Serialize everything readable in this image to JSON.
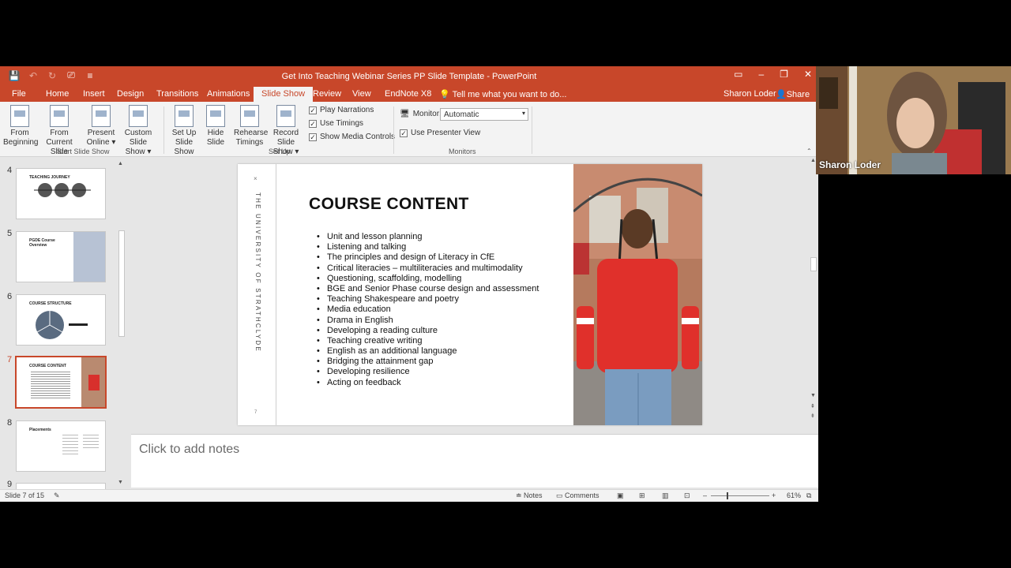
{
  "window": {
    "title": "Get Into Teaching Webinar Series PP Slide Template - PowerPoint",
    "controls": [
      "ribbon-display-icon",
      "minimize-icon",
      "restore-icon",
      "close-icon"
    ]
  },
  "quick_access": [
    "save-icon",
    "undo-icon",
    "redo-icon",
    "start-from-beginning-icon",
    "customize-qat-icon"
  ],
  "tabs": {
    "file": "File",
    "home": "Home",
    "insert": "Insert",
    "design": "Design",
    "transitions": "Transitions",
    "animations": "Animations",
    "slideshow": "Slide Show",
    "review": "Review",
    "view": "View",
    "endnote": "EndNote X8",
    "tell": "Tell me what you want to do...",
    "user": "Sharon Loder",
    "share": "Share"
  },
  "ribbon": {
    "from_beginning_1": "From",
    "from_beginning_2": "Beginning",
    "from_current_1": "From",
    "from_current_2": "Current Slide",
    "present_online_1": "Present",
    "present_online_2": "Online ▾",
    "custom_show_1": "Custom Slide",
    "custom_show_2": "Show ▾",
    "group_start": "Start Slide Show",
    "setup_1": "Set Up",
    "setup_2": "Slide Show",
    "hide_1": "Hide",
    "hide_2": "Slide",
    "rehearse_1": "Rehearse",
    "rehearse_2": "Timings",
    "record_1": "Record Slide",
    "record_2": "Show ▾",
    "play_narrations": "Play Narrations",
    "use_timings": "Use Timings",
    "show_media_controls": "Show Media Controls",
    "group_setup": "Set Up",
    "monitor_label": "Monitor:",
    "monitor_value": "Automatic",
    "use_presenter_view": "Use Presenter View",
    "group_monitors": "Monitors",
    "check": "✓"
  },
  "thumbnails": [
    {
      "num": "4",
      "title": "TEACHING JOURNEY"
    },
    {
      "num": "5",
      "title": "PGDE Course Overview"
    },
    {
      "num": "6",
      "title": "COURSE STRUCTURE"
    },
    {
      "num": "7",
      "title": "COURSE CONTENT"
    },
    {
      "num": "8",
      "title": "Placements"
    },
    {
      "num": "9",
      "title": ""
    }
  ],
  "slide": {
    "side_text": "THE UNIVERSITY OF STRATHCLYDE",
    "x_mark": "×",
    "page_number": "7",
    "title": "COURSE CONTENT",
    "bullets": [
      "Unit and lesson planning",
      "Listening and talking",
      "The principles and design of Literacy in CfE",
      "Critical literacies – multiliteracies and multimodality",
      "Questioning, scaffolding, modelling",
      "BGE and Senior Phase course design and assessment",
      "Teaching Shakespeare and poetry",
      "Media education",
      "Drama in English",
      "Developing a reading culture",
      "Teaching creative writing",
      "English as an additional language",
      "Bridging the attainment gap",
      "Developing resilience",
      "Acting on feedback"
    ]
  },
  "notes": {
    "placeholder": "Click to add notes"
  },
  "status": {
    "slide_count": "Slide 7 of 15",
    "notes": "Notes",
    "comments": "Comments",
    "zoom": "61%"
  },
  "webcam": {
    "name": "Sharon Loder"
  },
  "colors": {
    "accent": "#c8472a",
    "ribbon_bg": "#f3f3f3",
    "workspace_bg": "#e6e6e6"
  }
}
